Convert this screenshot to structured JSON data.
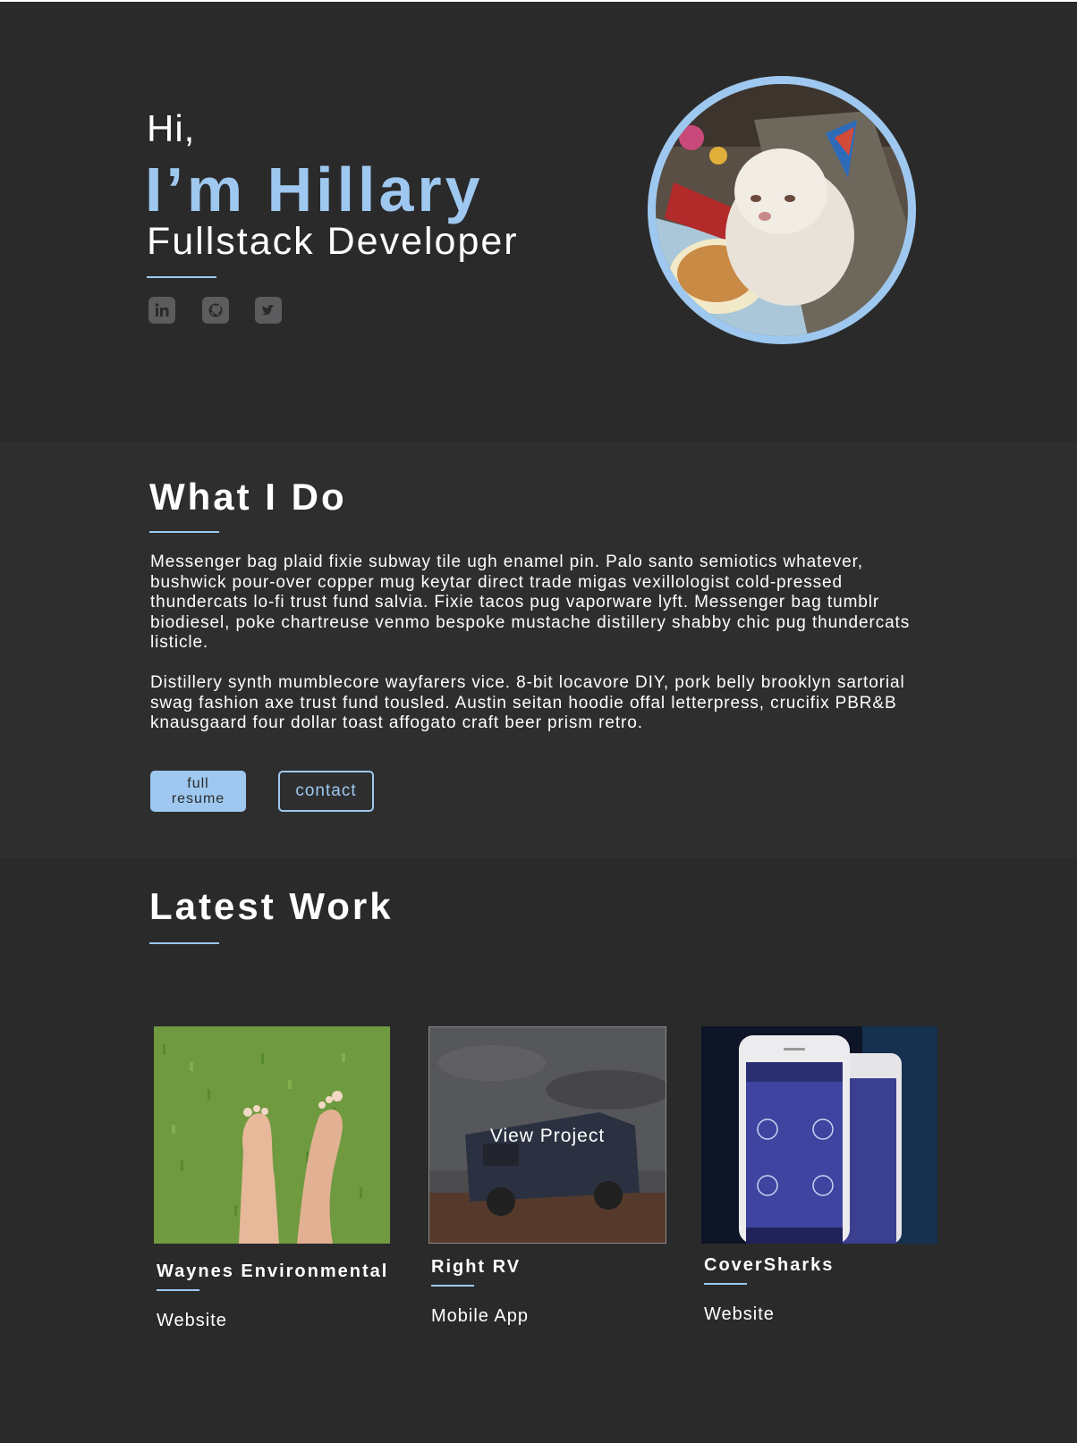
{
  "hero": {
    "greeting": "Hi,",
    "name": "I’m Hillary",
    "role": "Fullstack Developer",
    "social": [
      {
        "icon": "linkedin-icon"
      },
      {
        "icon": "github-icon"
      },
      {
        "icon": "twitter-icon"
      }
    ],
    "portrait": {
      "icon": "dog-in-party-hat-photo"
    }
  },
  "what": {
    "heading": "What I Do",
    "paragraphs": [
      "Messenger bag plaid fixie subway tile ugh enamel pin. Palo santo semiotics whatever, bushwick pour-over copper mug keytar direct trade migas vexillologist cold-pressed thundercats lo-fi trust fund salvia. Fixie tacos pug vaporware lyft. Messenger bag tumblr biodiesel, poke chartreuse venmo bespoke mustache distillery shabby chic pug thundercats listicle.",
      "Distillery synth mumblecore wayfarers vice. 8-bit locavore DIY, pork belly brooklyn sartorial swag fashion axe trust fund tousled. Austin seitan hoodie offal letterpress, crucifix PBR&B knausgaard four dollar toast affogato craft beer prism retro."
    ],
    "buttons": {
      "resume_line1": "full",
      "resume_line2": "resume",
      "contact": "contact"
    }
  },
  "work": {
    "heading": "Latest Work",
    "projects": [
      {
        "title": "Waynes Environmental",
        "type": "Website"
      },
      {
        "title": "Right RV",
        "type": "Mobile App",
        "overlay": "View Project"
      },
      {
        "title": "CoverSharks",
        "type": "Website"
      }
    ]
  },
  "colors": {
    "accent": "#9ec8ef",
    "background": "#2a2a2b",
    "section_alt": "#2e2e2f",
    "text": "#ffffff",
    "icon": "#5c5c5e"
  }
}
